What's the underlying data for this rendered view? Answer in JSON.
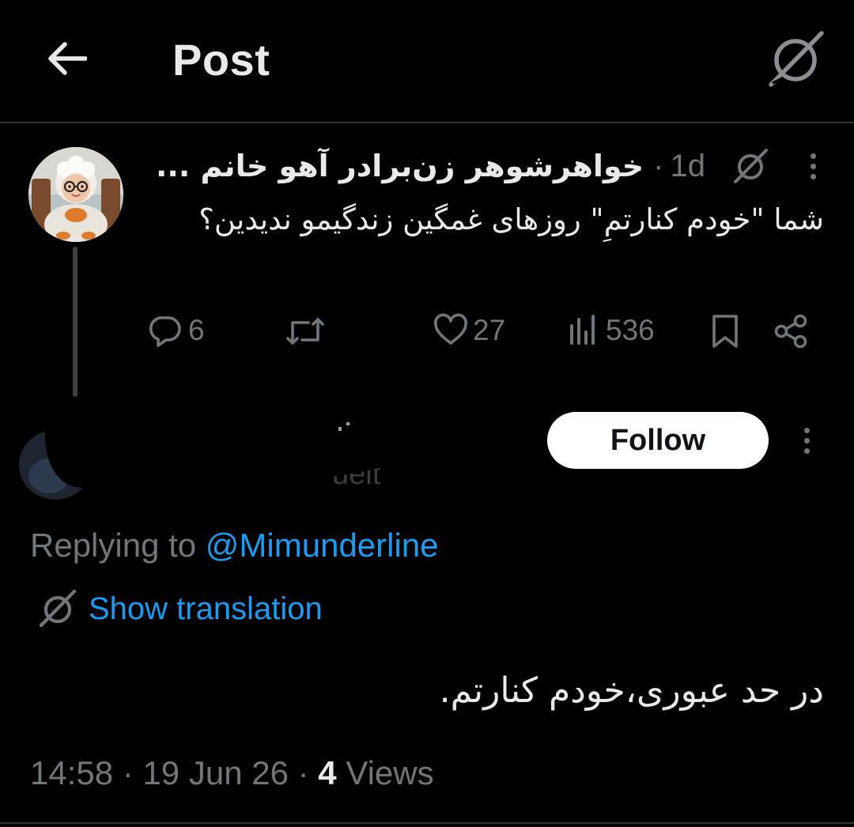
{
  "header": {
    "title": "Post",
    "back_icon": "arrow-left-icon",
    "grok_icon": "grok-icon"
  },
  "parent_post": {
    "display_name": "خواهرشوهر زن‌برادر آهو خانم",
    "truncation": "...",
    "separator": "·",
    "time_ago": "1d",
    "text": "شما \"خودم کنارتمِ\" روزهای غمگین زندگیمو ندیدین؟",
    "actions": {
      "replies": "6",
      "likes": "27",
      "views": "536"
    }
  },
  "reply_author": {
    "follow_label": "Follow",
    "redacted": true
  },
  "reply": {
    "replying_prefix": "Replying to",
    "replying_handle": "@Mimunderline",
    "translation_label": "Show translation",
    "text": "در حد عبوری،خودم کنارتم.",
    "time": "14:58",
    "date": "19 Jun 26",
    "separator": "·",
    "views_count": "4",
    "views_label": "Views"
  },
  "colors": {
    "background": "#000000",
    "text_primary": "#e7e9ea",
    "text_secondary": "#71767b",
    "accent": "#1d9bf0",
    "divider": "#2f3336",
    "follow_bg": "#ffffff"
  }
}
